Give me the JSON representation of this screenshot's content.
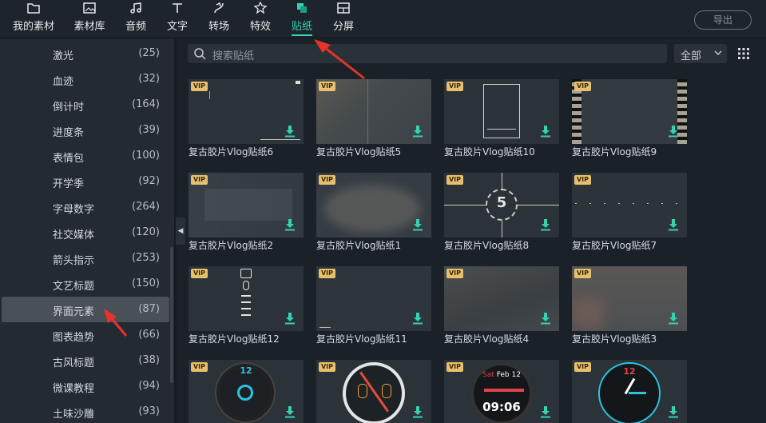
{
  "toolbar": {
    "tabs": [
      {
        "label": "我的素材",
        "icon": "folder-icon"
      },
      {
        "label": "素材库",
        "icon": "media-library-icon"
      },
      {
        "label": "音频",
        "icon": "music-note-icon"
      },
      {
        "label": "文字",
        "icon": "text-icon"
      },
      {
        "label": "转场",
        "icon": "transition-icon"
      },
      {
        "label": "特效",
        "icon": "effects-star-icon"
      },
      {
        "label": "贴纸",
        "icon": "sticker-icon"
      },
      {
        "label": "分屏",
        "icon": "split-screen-icon"
      }
    ],
    "active_tab": "贴纸",
    "export_label": "导出"
  },
  "sidebar": {
    "categories": [
      {
        "name": "激光",
        "count": "(25)"
      },
      {
        "name": "血迹",
        "count": "(32)"
      },
      {
        "name": "倒计时",
        "count": "(164)"
      },
      {
        "name": "进度条",
        "count": "(39)"
      },
      {
        "name": "表情包",
        "count": "(100)"
      },
      {
        "name": "开学季",
        "count": "(92)"
      },
      {
        "name": "字母数字",
        "count": "(264)"
      },
      {
        "name": "社交媒体",
        "count": "(120)"
      },
      {
        "name": "箭头指示",
        "count": "(253)"
      },
      {
        "name": "文艺标题",
        "count": "(150)"
      },
      {
        "name": "界面元素",
        "count": "(87)"
      },
      {
        "name": "图表趋势",
        "count": "(66)"
      },
      {
        "name": "古风标题",
        "count": "(38)"
      },
      {
        "name": "微课教程",
        "count": "(94)"
      },
      {
        "name": "土味沙雕",
        "count": "(93)"
      }
    ],
    "selected": "界面元素"
  },
  "search": {
    "placeholder": "搜索贴纸"
  },
  "filter": {
    "value": "全部"
  },
  "badge": "VIP",
  "stickers": [
    {
      "title": "复古胶片Vlog贴纸6"
    },
    {
      "title": "复古胶片Vlog贴纸5"
    },
    {
      "title": "复古胶片Vlog贴纸10"
    },
    {
      "title": "复古胶片Vlog贴纸9"
    },
    {
      "title": "复古胶片Vlog贴纸2"
    },
    {
      "title": "复古胶片Vlog贴纸1"
    },
    {
      "title": "复古胶片Vlog贴纸8"
    },
    {
      "title": "复古胶片Vlog贴纸7"
    },
    {
      "title": "复古胶片Vlog贴纸12"
    },
    {
      "title": "复古胶片Vlog贴纸11"
    },
    {
      "title": "复古胶片Vlog贴纸4"
    },
    {
      "title": "复古胶片Vlog贴纸3"
    },
    {
      "title": ""
    },
    {
      "title": ""
    },
    {
      "title": ""
    },
    {
      "title": ""
    }
  ],
  "thumb_text": {
    "badge_5": "5",
    "watch_time": "09:06",
    "watch_top": "Sat",
    "watch_date": "Feb 12",
    "dial_12": "12"
  },
  "colors": {
    "accent": "#35d2b2",
    "vip": "#e6c06e",
    "annotation_arrow": "#e8322a"
  }
}
